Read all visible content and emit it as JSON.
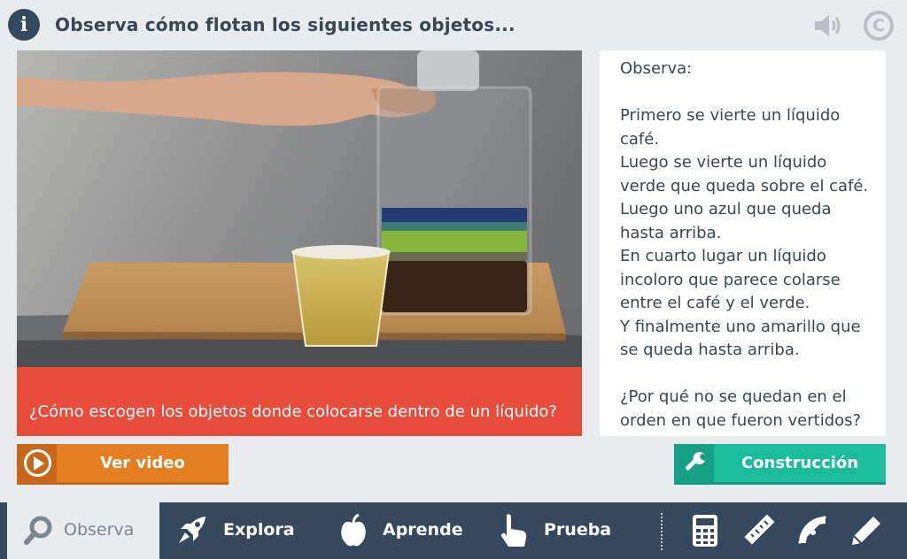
{
  "header": {
    "title": "Observa cómo flotan los siguientes objetos...",
    "info_icon": "info-icon",
    "speaker_icon": "speaker-icon",
    "copyright_icon": "copyright-icon",
    "copyright_symbol": "C"
  },
  "question": {
    "text": "¿Cómo escogen los objetos donde colocarse dentro de un líquido?"
  },
  "description": {
    "lines": [
      "Observa:",
      "",
      "Primero se vierte un líquido",
      "café.",
      "Luego se vierte un líquido",
      "verde que queda sobre el café.",
      "Luego uno azul que queda",
      "hasta arriba.",
      "En cuarto lugar un líquido",
      "incoloro que parece colarse",
      "entre el café y el verde.",
      "Y finalmente uno amarillo que",
      "se queda hasta arriba.",
      "",
      "¿Por qué no se quedan en el",
      "orden en que fueron vertidos?"
    ]
  },
  "buttons": {
    "video": {
      "label": "Ver video",
      "icon": "play-circle-icon"
    },
    "build": {
      "label": "Construcción",
      "icon": "wrench-icon"
    }
  },
  "nav": {
    "items": [
      {
        "label": "Observa",
        "icon": "search-icon",
        "active": true
      },
      {
        "label": "Explora",
        "icon": "rocket-icon",
        "active": false
      },
      {
        "label": "Aprende",
        "icon": "apple-icon",
        "active": false
      },
      {
        "label": "Prueba",
        "icon": "hand-pointer-icon",
        "active": false
      }
    ],
    "tools": [
      "calculator-icon",
      "ruler-icon",
      "protractor-icon",
      "pencil-icon"
    ]
  },
  "colors": {
    "header_text": "#3a4654",
    "question_bar": "#e74c3c",
    "video_button": "#e67e22",
    "build_button": "#1abc9c",
    "nav_bg": "#34495e",
    "nav_active_bg": "#e9ecef"
  }
}
